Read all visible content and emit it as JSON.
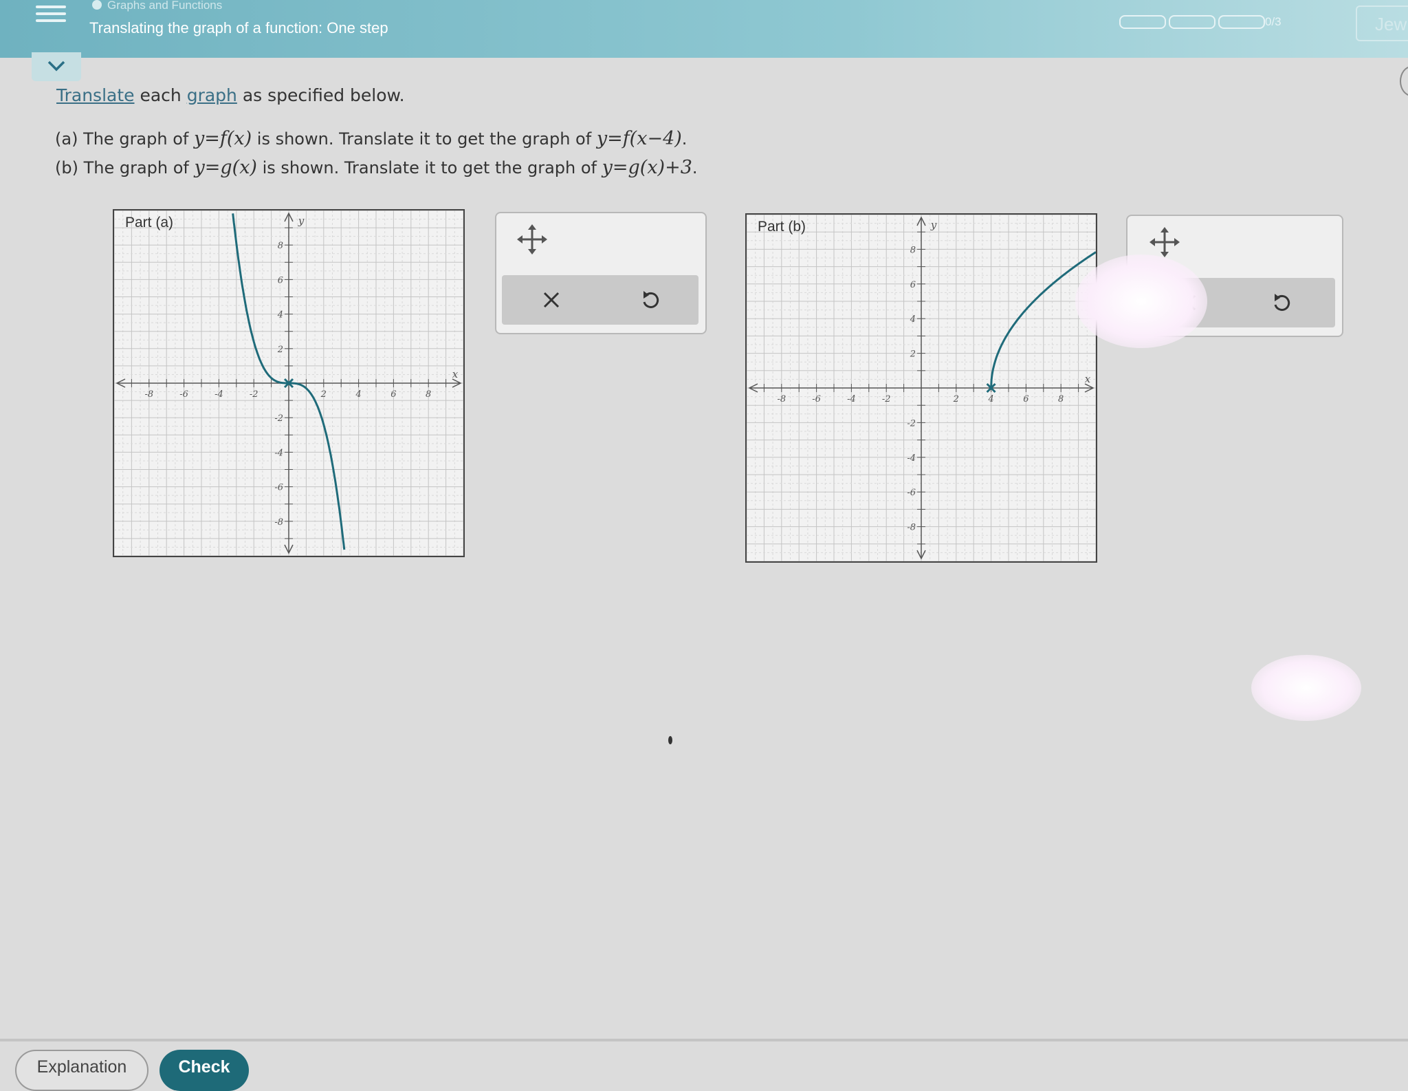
{
  "header": {
    "module": "Graphs and Functions",
    "lesson": "Translating the graph of a function: One step",
    "progress": "0/3",
    "progress_segments": 3,
    "user": "Jew"
  },
  "colors": {
    "topbar": "#6fb2c0",
    "curve": "#1f6b7a",
    "check_button": "#1e6a78"
  },
  "icons": [
    "menu-icon",
    "chevron-down-icon",
    "move-icon",
    "close-icon",
    "undo-icon"
  ],
  "problem": {
    "instruction_words": [
      "Translate",
      " each ",
      "graph",
      " as specified below."
    ],
    "part_a": {
      "prefix": "(a) The graph of ",
      "given": "y=f(x)",
      "middle": " is shown. Translate it to get the graph of ",
      "target": "y=f(x−4)",
      "suffix": "."
    },
    "part_b": {
      "prefix": "(b) The graph of ",
      "given": "y=g(x)",
      "middle": " is shown. Translate it to get the graph of ",
      "target": "y=g(x)+3",
      "suffix": "."
    }
  },
  "graphs": [
    {
      "label": "Part (a)",
      "x_axis_label": "x",
      "y_axis_label": "y",
      "xlim": [
        -10,
        10
      ],
      "ylim": [
        -10,
        10
      ],
      "x_ticks": [
        "-8",
        "-6",
        "-4",
        "-2",
        "2",
        "4",
        "6",
        "8"
      ],
      "y_ticks": [
        "8",
        "6",
        "4",
        "2",
        "-2",
        "-4",
        "-6",
        "-8"
      ],
      "curve": "cubic",
      "key_point": [
        0,
        0
      ]
    },
    {
      "label": "Part (b)",
      "x_axis_label": "x",
      "y_axis_label": "y",
      "xlim": [
        -10,
        10
      ],
      "ylim": [
        -10,
        10
      ],
      "x_ticks": [
        "-8",
        "-6",
        "-4",
        "-2",
        "2",
        "4",
        "6",
        "8"
      ],
      "y_ticks": [
        "8",
        "6",
        "4",
        "2",
        "-2",
        "-4",
        "-6",
        "-8"
      ],
      "curve": "sqrt",
      "key_point": [
        4,
        0
      ]
    }
  ],
  "footer": {
    "explanation": "Explanation",
    "check": "Check"
  }
}
